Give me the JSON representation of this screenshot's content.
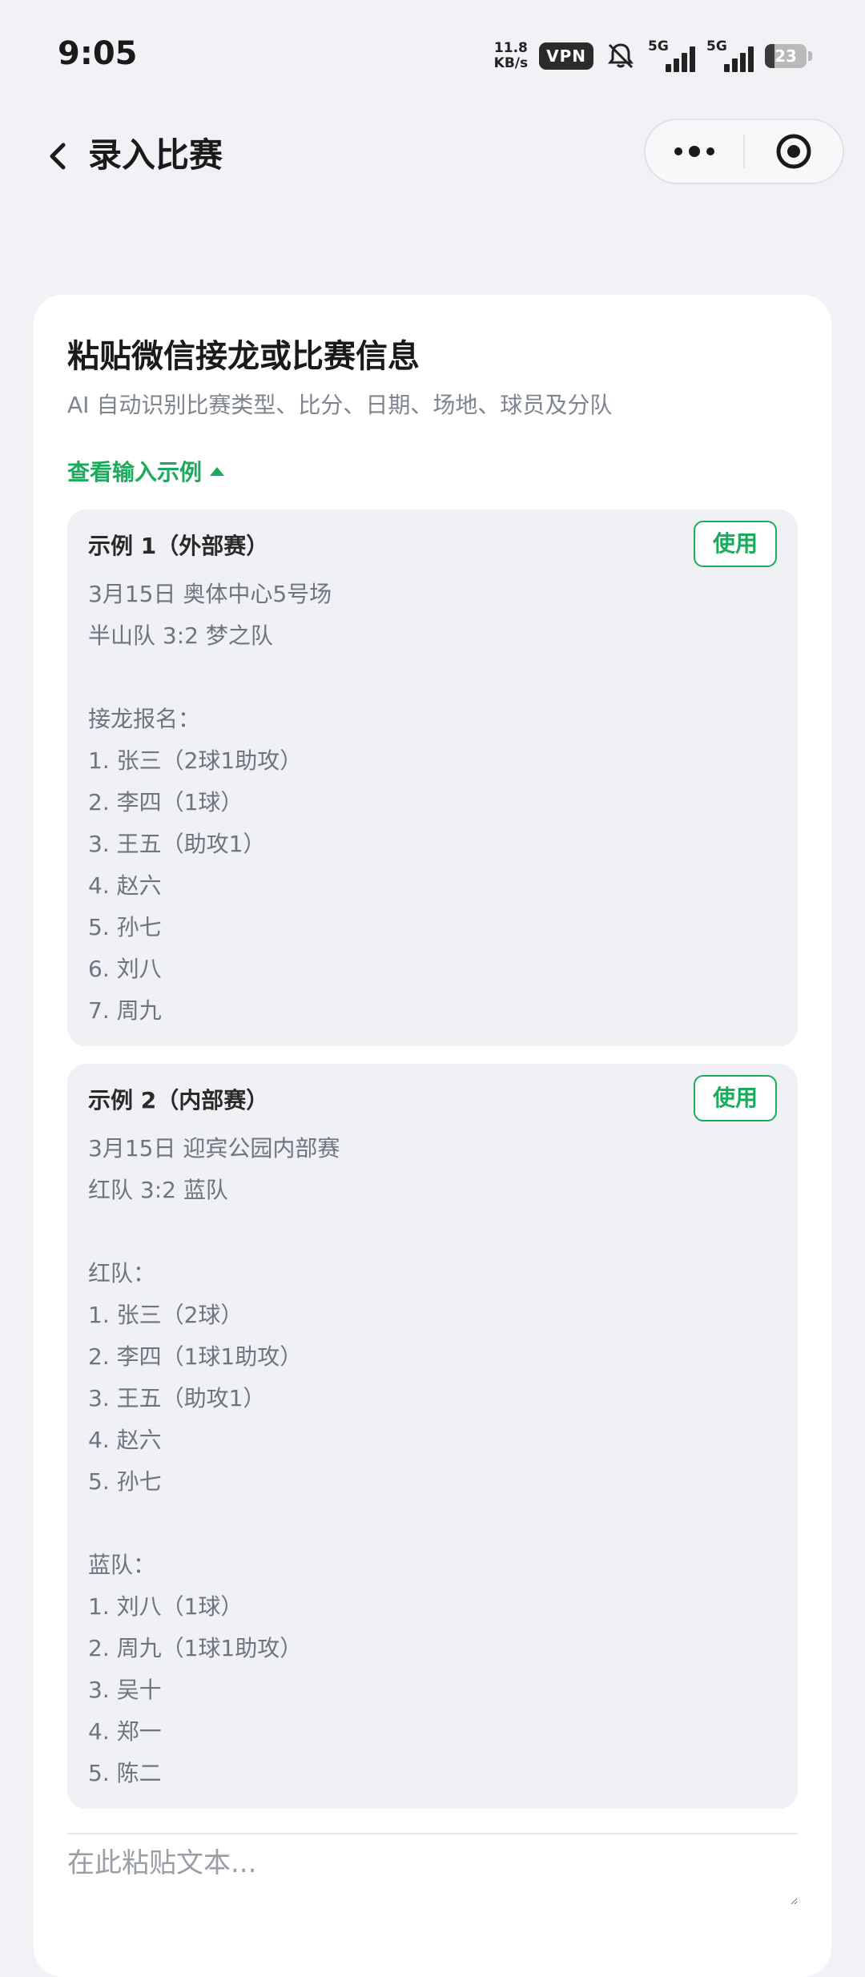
{
  "status_bar": {
    "time": "9:05",
    "net_speed_value": "11.8",
    "net_speed_unit": "KB/s",
    "vpn": "VPN",
    "sim1_label": "5G",
    "sim2_label": "5G",
    "battery": "23",
    "battery_level": 0.23,
    "icons": [
      "bell-muted-icon",
      "signal-icon",
      "battery-icon"
    ]
  },
  "navbar": {
    "title": "录入比赛",
    "back_icon": "chevron-left-icon",
    "more_icon": "more-dots-icon",
    "close_icon": "target-circle-icon"
  },
  "card": {
    "title": "粘贴微信接龙或比赛信息",
    "subtitle": "AI 自动识别比赛类型、比分、日期、场地、球员及分队",
    "toggle_label": "查看输入示例",
    "examples": [
      {
        "title": "示例 1（外部赛）",
        "use_label": "使用",
        "lines": [
          "3月15日 奥体中心5号场",
          "半山队 3:2 梦之队",
          "",
          "接龙报名：",
          "1. 张三（2球1助攻）",
          "2. 李四（1球）",
          "3. 王五（助攻1）",
          "4. 赵六",
          "5. 孙七",
          "6. 刘八",
          "7. 周九"
        ]
      },
      {
        "title": "示例 2（内部赛）",
        "use_label": "使用",
        "lines": [
          "3月15日 迎宾公园内部赛",
          "红队 3:2 蓝队",
          "",
          "红队：",
          "1. 张三（2球）",
          "2. 李四（1球1助攻）",
          "3. 王五（助攻1）",
          "4. 赵六",
          "5. 孙七",
          "",
          "蓝队：",
          "1. 刘八（1球）",
          "2. 周九（1球1助攻）",
          "3. 吴十",
          "4. 郑一",
          "5. 陈二"
        ]
      }
    ],
    "input_placeholder": "在此粘贴文本..."
  },
  "colors": {
    "accent": "#1aab5c",
    "background": "#f1f2f6",
    "example_bg": "#f0f1f5"
  }
}
